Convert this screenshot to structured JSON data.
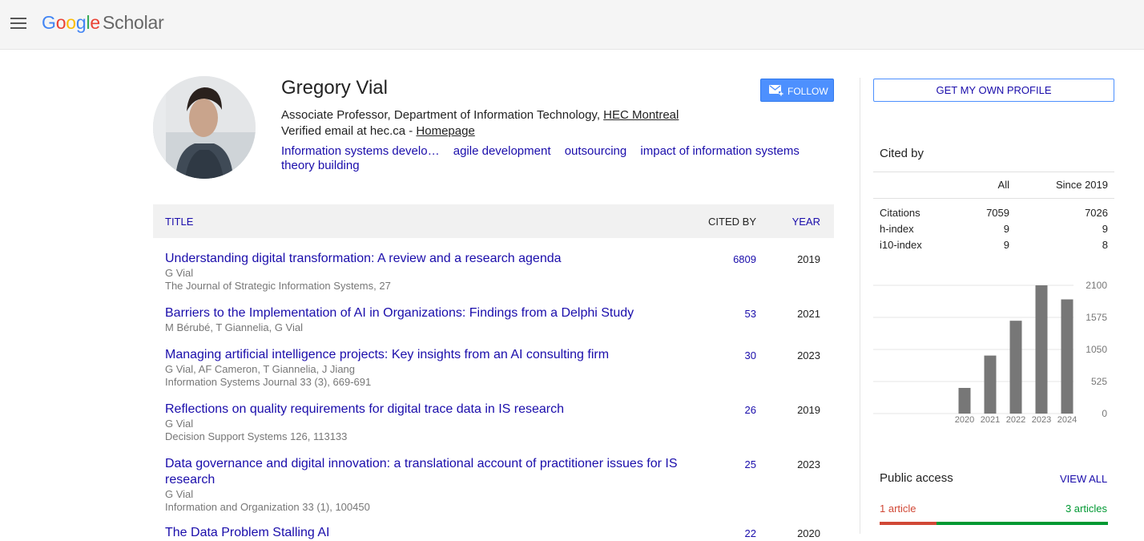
{
  "header": {
    "logo_google": "Google",
    "logo_scholar": "Scholar"
  },
  "profile": {
    "name": "Gregory Vial",
    "affiliation_prefix": "Associate Professor, Department of Information Technology, ",
    "affiliation_link": "HEC Montreal",
    "email_prefix": "Verified email at hec.ca - ",
    "homepage_link": "Homepage",
    "interests": [
      "Information systems develo…",
      "agile development",
      "outsourcing",
      "impact of information systems",
      "theory building"
    ],
    "follow_label": "FOLLOW"
  },
  "table": {
    "headers": {
      "title": "TITLE",
      "cited_by": "CITED BY",
      "year": "YEAR"
    },
    "rows": [
      {
        "title": "Understanding digital transformation: A review and a research agenda",
        "authors": "G Vial",
        "venue": "The Journal of Strategic Information Systems, 27",
        "cited": "6809",
        "year": "2019"
      },
      {
        "title": "Barriers to the Implementation of AI in Organizations: Findings from a Delphi Study",
        "authors": "M Bérubé, T Giannelia, G Vial",
        "venue": "",
        "cited": "53",
        "year": "2021"
      },
      {
        "title": "Managing artificial intelligence projects: Key insights from an AI consulting firm",
        "authors": "G Vial, AF Cameron, T Giannelia, J Jiang",
        "venue": "Information Systems Journal 33 (3), 669-691",
        "cited": "30",
        "year": "2023"
      },
      {
        "title": "Reflections on quality requirements for digital trace data in IS research",
        "authors": "G Vial",
        "venue": "Decision Support Systems 126, 113133",
        "cited": "26",
        "year": "2019"
      },
      {
        "title": "Data governance and digital innovation: a translational account of practitioner issues for IS research",
        "authors": "G Vial",
        "venue": "Information and Organization 33 (1), 100450",
        "cited": "25",
        "year": "2023"
      },
      {
        "title": "The Data Problem Stalling AI",
        "authors": "",
        "venue": "",
        "cited": "22",
        "year": "2020"
      }
    ]
  },
  "sidebar": {
    "own_profile_label": "GET MY OWN PROFILE",
    "cited_by_title": "Cited by",
    "stats_headers": {
      "all": "All",
      "since": "Since 2019"
    },
    "stats": [
      {
        "label": "Citations",
        "all": "7059",
        "since": "7026"
      },
      {
        "label": "h-index",
        "all": "9",
        "since": "9"
      },
      {
        "label": "i10-index",
        "all": "9",
        "since": "8"
      }
    ],
    "public_access": {
      "title": "Public access",
      "view_all": "VIEW ALL",
      "not_available": "1 article",
      "available": "3 articles",
      "available_fraction": 0.75
    }
  },
  "chart_data": {
    "type": "bar",
    "categories": [
      "2020",
      "2021",
      "2022",
      "2023",
      "2024"
    ],
    "values": [
      420,
      950,
      1520,
      2100,
      1870
    ],
    "ylim": [
      0,
      2100
    ],
    "yticks": [
      0,
      525,
      1050,
      1575,
      2100
    ],
    "bar_color": "#777777",
    "grid": true
  }
}
